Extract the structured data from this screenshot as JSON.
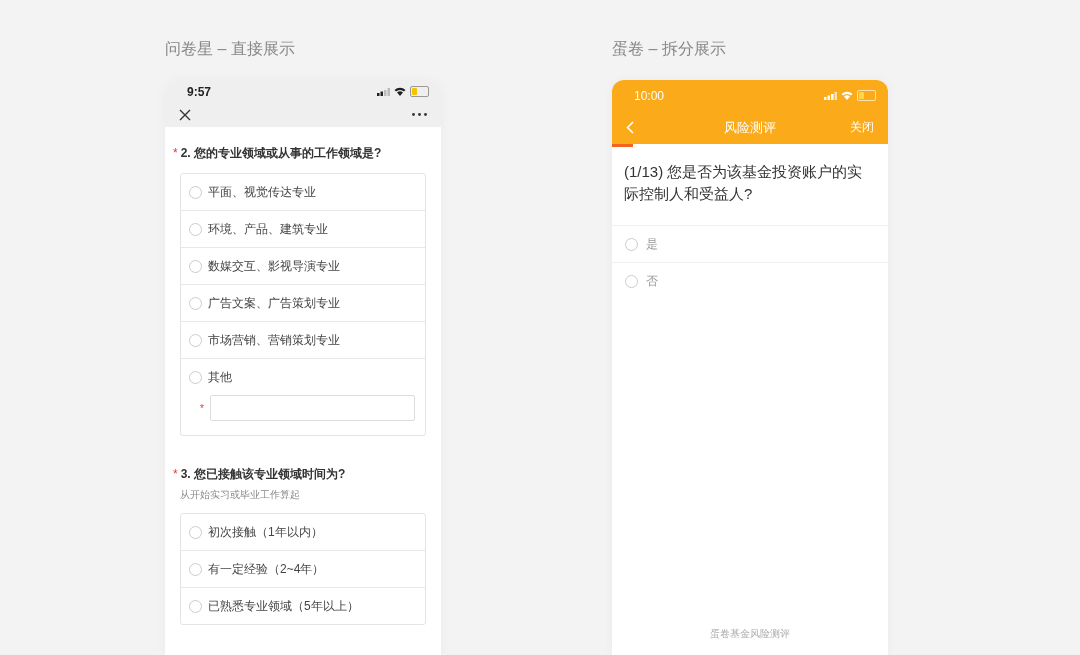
{
  "left": {
    "caption": "问卷星 – 直接展示",
    "status_bar": {
      "time": "9:57"
    },
    "questions": [
      {
        "mark": "*",
        "title": "2. 您的专业领域或从事的工作领域是?",
        "options": [
          {
            "label": "平面、视觉传达专业",
            "selected": false
          },
          {
            "label": "环境、产品、建筑专业",
            "selected": false
          },
          {
            "label": "数媒交互、影视导演专业",
            "selected": false
          },
          {
            "label": "广告文案、广告策划专业",
            "selected": false
          },
          {
            "label": "市场营销、营销策划专业",
            "selected": false
          },
          {
            "label": "其他",
            "selected": false,
            "kind": "other",
            "field_mark": "*"
          }
        ]
      },
      {
        "mark": "*",
        "title": "3. 您已接触该专业领域时间为?",
        "hint": "从开始实习或毕业工作算起",
        "options": [
          {
            "label": "初次接触（1年以内）",
            "selected": false
          },
          {
            "label": "有一定经验（2~4年）",
            "selected": false
          },
          {
            "label": "已熟悉专业领域（5年以上）",
            "selected": false
          }
        ]
      }
    ]
  },
  "right": {
    "caption": "蛋卷 – 拆分展示",
    "status_bar": {
      "time": "10:00"
    },
    "nav": {
      "title": "风险测评",
      "close": "关闭"
    },
    "progress": {
      "level": 0.077
    },
    "question": "(1/13) 您是否为该基金投资账户的实际控制人和受益人?",
    "options": [
      {
        "label": "是",
        "selected": false
      },
      {
        "label": "否",
        "selected": false
      }
    ],
    "footer": "蛋卷基金风险测评"
  }
}
